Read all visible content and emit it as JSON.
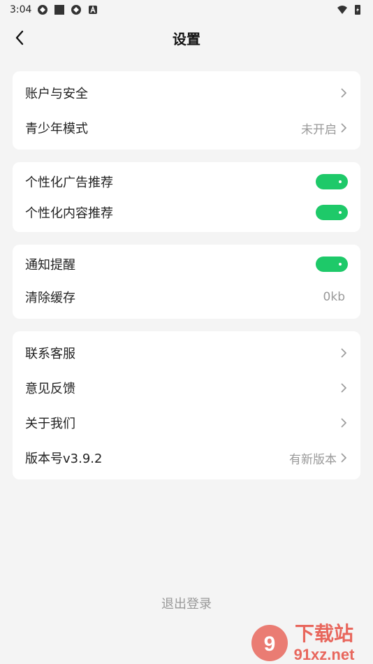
{
  "status_bar": {
    "time": "3:04"
  },
  "nav": {
    "title": "设置"
  },
  "groups": [
    {
      "rows": [
        {
          "label": "账户与安全",
          "value": "",
          "control": "chevron"
        },
        {
          "label": "青少年模式",
          "value": "未开启",
          "control": "chevron"
        }
      ]
    },
    {
      "rows": [
        {
          "label": "个性化广告推荐",
          "control": "toggle",
          "on": true
        },
        {
          "label": "个性化内容推荐",
          "control": "toggle",
          "on": true
        }
      ]
    },
    {
      "rows": [
        {
          "label": "通知提醒",
          "control": "toggle",
          "on": true
        },
        {
          "label": "清除缓存",
          "value": "0kb",
          "control": "none"
        }
      ]
    },
    {
      "rows": [
        {
          "label": "联系客服",
          "value": "",
          "control": "chevron"
        },
        {
          "label": "意见反馈",
          "value": "",
          "control": "chevron"
        },
        {
          "label": "关于我们",
          "value": "",
          "control": "chevron"
        },
        {
          "label": "版本号v3.9.2",
          "value": "有新版本",
          "control": "chevron"
        }
      ]
    }
  ],
  "logout_label": "退出登录",
  "watermark": {
    "text_cn": "下载站",
    "text_url": "91xz.net"
  },
  "colors": {
    "toggle_on": "#1ec969",
    "background": "#f4f4f4",
    "card": "#ffffff",
    "muted": "#999999"
  }
}
